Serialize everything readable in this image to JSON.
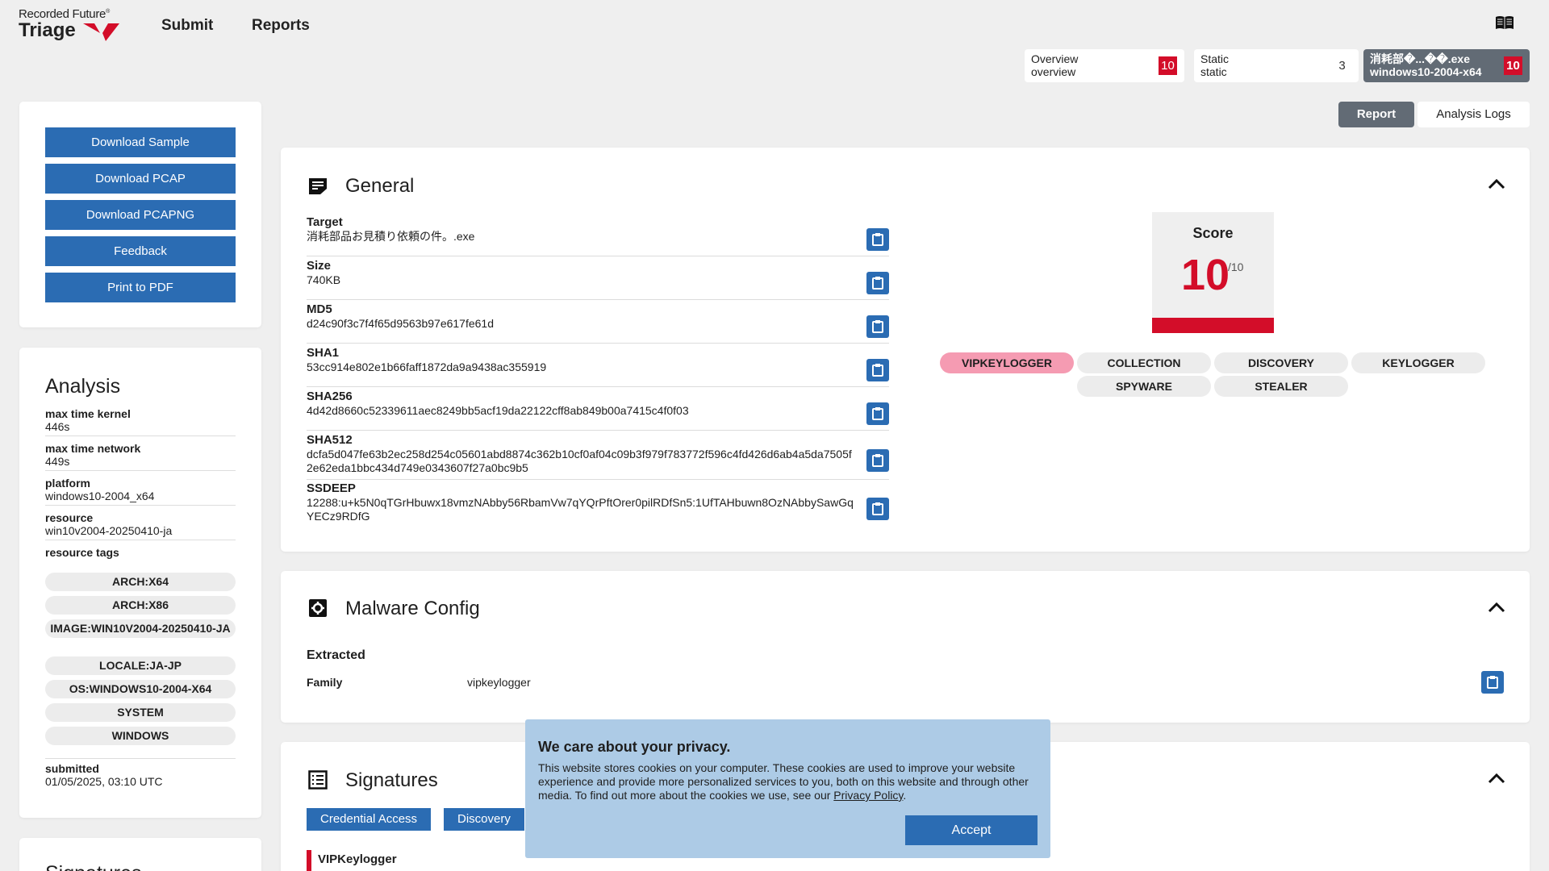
{
  "header": {
    "brand": "Recorded Future",
    "brand_mark": "®",
    "product": "Triage",
    "nav": [
      "Submit",
      "Reports"
    ]
  },
  "tabs": [
    {
      "line1": "Overview",
      "line2": "overview",
      "score": "10"
    },
    {
      "line1": "Static",
      "line2": "static",
      "score": "3"
    },
    {
      "line1": "消耗部�...��.exe",
      "line2": "windows10-2004-x64",
      "score": "10"
    }
  ],
  "view_buttons": {
    "report": "Report",
    "logs": "Analysis Logs"
  },
  "sidebar": {
    "buttons": [
      "Download Sample",
      "Download PCAP",
      "Download PCAPNG",
      "Feedback",
      "Print to PDF"
    ],
    "analysis": {
      "title": "Analysis",
      "fields": [
        {
          "k": "max time kernel",
          "v": "446s"
        },
        {
          "k": "max time network",
          "v": "449s"
        },
        {
          "k": "platform",
          "v": "windows10-2004_x64"
        },
        {
          "k": "resource",
          "v": "win10v2004-20250410-ja"
        }
      ],
      "resource_tags_label": "resource tags",
      "resource_tags": [
        "ARCH:X64",
        "ARCH:X86",
        "IMAGE:WIN10V2004-20250410-JA",
        "LOCALE:JA-JP",
        "OS:WINDOWS10-2004-X64",
        "SYSTEM",
        "WINDOWS"
      ],
      "submitted_label": "submitted",
      "submitted": "01/05/2025, 03:10 UTC"
    },
    "next_title": "Signatures"
  },
  "general": {
    "title": "General",
    "fields": [
      {
        "k": "Target",
        "v": "消耗部品お見積り依頼の件。.exe"
      },
      {
        "k": "Size",
        "v": "740KB"
      },
      {
        "k": "MD5",
        "v": "d24c90f3c7f4f65d9563b97e617fe61d"
      },
      {
        "k": "SHA1",
        "v": "53cc914e802e1b66faff1872da9a9438ac355919"
      },
      {
        "k": "SHA256",
        "v": "4d42d8660c52339611aec8249bb5acf19da22122cff8ab849b00a7415c4f0f03"
      },
      {
        "k": "SHA512",
        "v": "dcfa5d047fe63b2ec258d254c05601abd8874c362b10cf0af04c09b3f979f783772f596c4fd426d6ab4a5da7505f2e62eda1bbc434d749e0343607f27a0bc9b5"
      },
      {
        "k": "SSDEEP",
        "v": "12288:u+k5N0qTGrHbuwx18vmzNAbby56RbamVw7qYQrPftOrer0pilRDfSn5:1UfTAHbuwn8OzNAbbySawGqYECz9RDfG"
      }
    ],
    "score_label": "Score",
    "score": "10",
    "score_max": "/10",
    "tags": [
      "VIPKEYLOGGER",
      "COLLECTION",
      "DISCOVERY",
      "KEYLOGGER",
      "SPYWARE",
      "STEALER"
    ]
  },
  "malware_config": {
    "title": "Malware Config",
    "extracted": "Extracted",
    "family_label": "Family",
    "family": "vipkeylogger"
  },
  "signatures": {
    "title": "Signatures",
    "tags": [
      "Credential Access",
      "Discovery"
    ],
    "first_item": "VIPKeylogger"
  },
  "privacy": {
    "title": "We care about your privacy.",
    "body": "This website stores cookies on your computer. These cookies are used to improve your website experience and provide more personalized services to you, both on this website and through other media. To find out more about the cookies we use, see our ",
    "link": "Privacy Policy",
    "end": ".",
    "accept": "Accept"
  },
  "colors": {
    "accent": "#2b6cb3",
    "danger": "#d30d29",
    "tab_active": "#626b75",
    "tag_hot": "#f59bb2"
  }
}
